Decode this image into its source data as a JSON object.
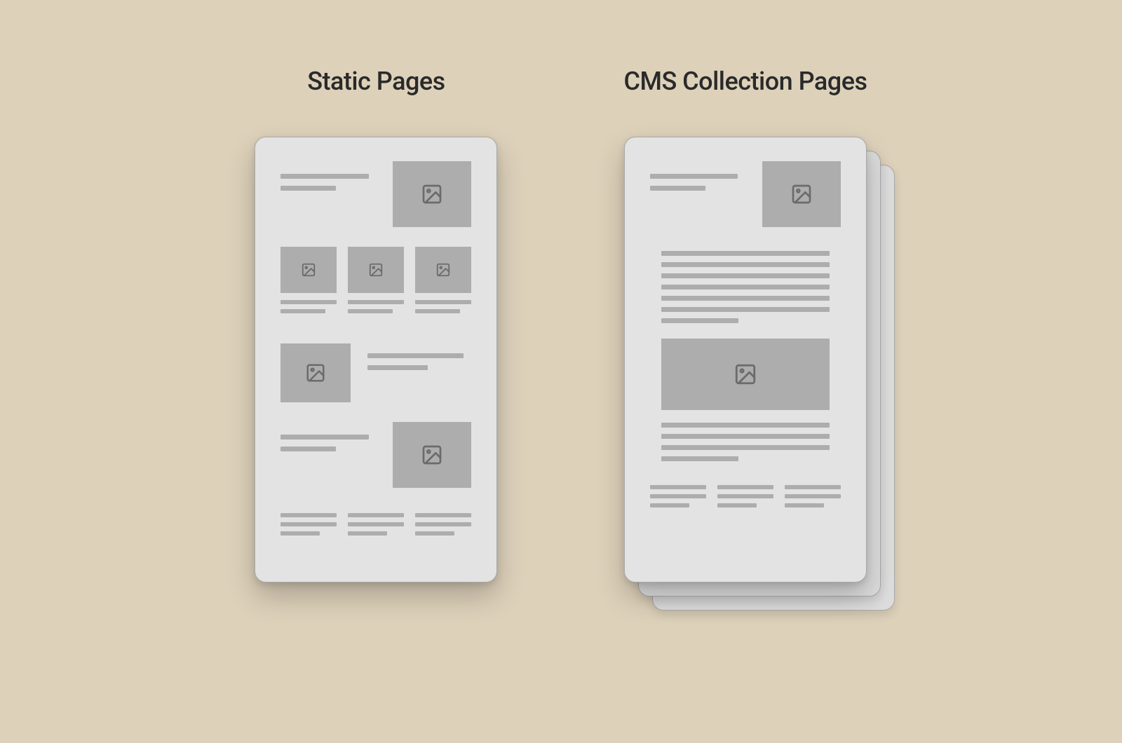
{
  "left": {
    "title": "Static Pages"
  },
  "right": {
    "title": "CMS Collection Pages"
  }
}
